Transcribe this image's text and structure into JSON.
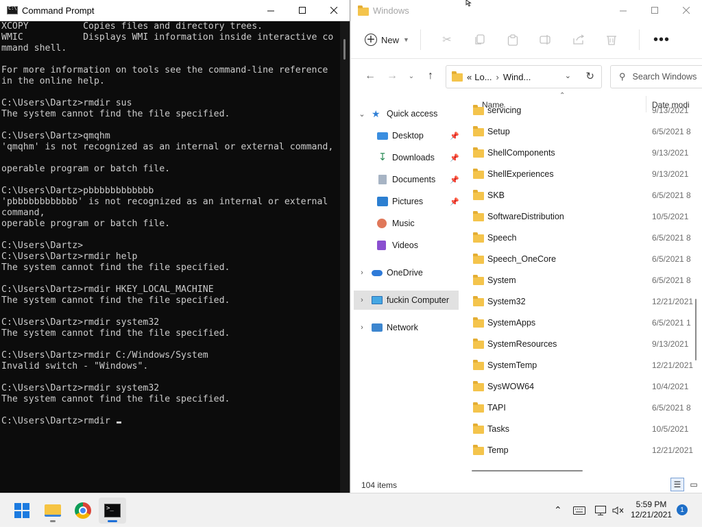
{
  "cmd": {
    "title": "Command Prompt",
    "lines": [
      "XCOPY          Copies files and directory trees.",
      "WMIC           Displays WMI information inside interactive co",
      "mmand shell.",
      "",
      "For more information on tools see the command-line reference",
      "in the online help.",
      "",
      "C:\\Users\\Dartz>rmdir sus",
      "The system cannot find the file specified.",
      "",
      "C:\\Users\\Dartz>qmqhm",
      "'qmqhm' is not recognized as an internal or external command,",
      "",
      "operable program or batch file.",
      "",
      "C:\\Users\\Dartz>pbbbbbbbbbbbb",
      "'pbbbbbbbbbbbb' is not recognized as an internal or external",
      "command,",
      "operable program or batch file.",
      "",
      "C:\\Users\\Dartz>",
      "C:\\Users\\Dartz>rmdir help",
      "The system cannot find the file specified.",
      "",
      "C:\\Users\\Dartz>rmdir HKEY_LOCAL_MACHINE",
      "The system cannot find the file specified.",
      "",
      "C:\\Users\\Dartz>rmdir system32",
      "The system cannot find the file specified.",
      "",
      "C:\\Users\\Dartz>rmdir C:/Windows/System",
      "Invalid switch - \"Windows\".",
      "",
      "C:\\Users\\Dartz>rmdir system32",
      "The system cannot find the file specified.",
      ""
    ],
    "prompt": "C:\\Users\\Dartz>rmdir "
  },
  "explorer": {
    "title": "Windows",
    "toolbar": {
      "new_label": "New"
    },
    "address": {
      "part1": "Lo...",
      "part2": "Wind...",
      "overflow": "«"
    },
    "search_placeholder": "Search Windows",
    "nav": [
      {
        "label": "Quick access",
        "icon": "star-icon"
      },
      {
        "label": "Desktop",
        "icon": "desktop-icon"
      },
      {
        "label": "Downloads",
        "icon": "download-icon"
      },
      {
        "label": "Documents",
        "icon": "documents-icon"
      },
      {
        "label": "Pictures",
        "icon": "pictures-icon"
      },
      {
        "label": "Music",
        "icon": "music-icon"
      },
      {
        "label": "Videos",
        "icon": "videos-icon"
      },
      {
        "label": "OneDrive",
        "icon": "cloud-icon"
      },
      {
        "label": "fuckin Computer",
        "icon": "computer-icon"
      },
      {
        "label": "Network",
        "icon": "network-icon"
      }
    ],
    "columns": {
      "name": "Name",
      "date": "Date modi"
    },
    "files": [
      {
        "name": "servicing",
        "date": "9/13/2021"
      },
      {
        "name": "Setup",
        "date": "6/5/2021 8"
      },
      {
        "name": "ShellComponents",
        "date": "9/13/2021"
      },
      {
        "name": "ShellExperiences",
        "date": "9/13/2021"
      },
      {
        "name": "SKB",
        "date": "6/5/2021 8"
      },
      {
        "name": "SoftwareDistribution",
        "date": "10/5/2021"
      },
      {
        "name": "Speech",
        "date": "6/5/2021 8"
      },
      {
        "name": "Speech_OneCore",
        "date": "6/5/2021 8"
      },
      {
        "name": "System",
        "date": "6/5/2021 8"
      },
      {
        "name": "System32",
        "date": "12/21/2021"
      },
      {
        "name": "SystemApps",
        "date": "6/5/2021 1"
      },
      {
        "name": "SystemResources",
        "date": "9/13/2021"
      },
      {
        "name": "SystemTemp",
        "date": "12/21/2021"
      },
      {
        "name": "SysWOW64",
        "date": "10/4/2021"
      },
      {
        "name": "TAPI",
        "date": "6/5/2021 8"
      },
      {
        "name": "Tasks",
        "date": "10/5/2021"
      },
      {
        "name": "Temp",
        "date": "12/21/2021"
      }
    ],
    "status": "104 items"
  },
  "taskbar": {
    "time": "5:59 PM",
    "date": "12/21/2021",
    "notifications": "1"
  },
  "colors": {
    "console_bg": "#0c0c0c",
    "console_fg": "#cccccc",
    "folder": "#f4c44c",
    "accent": "#1c6fd8"
  }
}
